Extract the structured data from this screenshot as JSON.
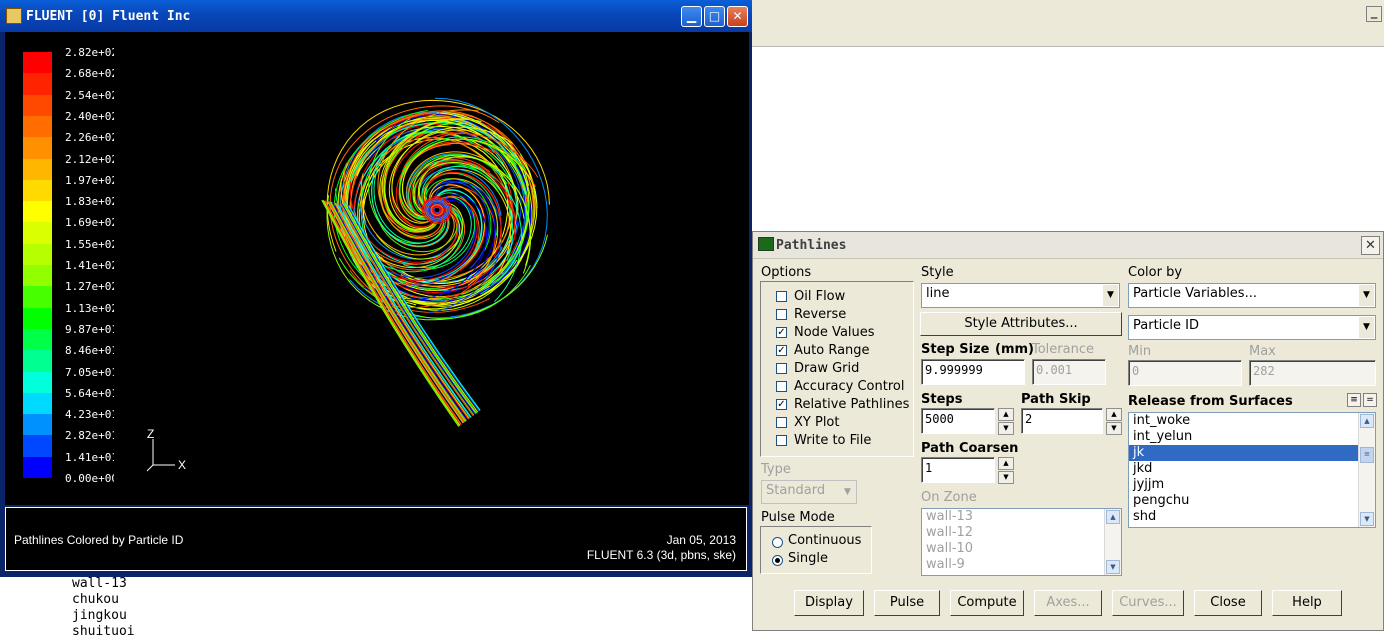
{
  "graphics_window": {
    "title": "FLUENT [0] Fluent Inc",
    "caption": "Pathlines Colored by Particle ID",
    "date": "Jan 05, 2013",
    "version": "FLUENT 6.3 (3d, pbns, ske)",
    "axis_z": "Z",
    "axis_x": "X",
    "colorbar": {
      "labels": [
        "2.82e+02",
        "2.68e+02",
        "2.54e+02",
        "2.40e+02",
        "2.26e+02",
        "2.12e+02",
        "1.97e+02",
        "1.83e+02",
        "1.69e+02",
        "1.55e+02",
        "1.41e+02",
        "1.27e+02",
        "1.13e+02",
        "9.87e+01",
        "8.46e+01",
        "7.05e+01",
        "5.64e+01",
        "4.23e+01",
        "2.82e+01",
        "1.41e+01",
        "0.00e+00"
      ],
      "colors": [
        "#ff0000",
        "#ff2400",
        "#ff4800",
        "#ff6d00",
        "#ff9100",
        "#ffb600",
        "#ffda00",
        "#ffff00",
        "#d9ff00",
        "#b6ff00",
        "#91ff00",
        "#48ff00",
        "#00ff00",
        "#00ff48",
        "#00ff91",
        "#00ffda",
        "#00daff",
        "#0091ff",
        "#0048ff",
        "#0000ff"
      ]
    }
  },
  "console": {
    "lines": [
      "wall-13",
      "chukou",
      "jingkou",
      "shuituoi"
    ]
  },
  "dialog": {
    "title": "Pathlines",
    "options": {
      "title": "Options",
      "items": [
        {
          "label": "Oil Flow",
          "checked": false
        },
        {
          "label": "Reverse",
          "checked": false
        },
        {
          "label": "Node Values",
          "checked": true
        },
        {
          "label": "Auto Range",
          "checked": true
        },
        {
          "label": "Draw Grid",
          "checked": false
        },
        {
          "label": "Accuracy Control",
          "checked": false
        },
        {
          "label": "Relative Pathlines",
          "checked": true
        },
        {
          "label": "XY Plot",
          "checked": false
        },
        {
          "label": "Write to File",
          "checked": false
        }
      ]
    },
    "type": {
      "label": "Type",
      "value": "Standard"
    },
    "pulse_mode": {
      "label": "Pulse Mode",
      "continuous": "Continuous",
      "single": "Single",
      "selected": "Single"
    },
    "style": {
      "label": "Style",
      "value": "line",
      "attributes_button": "Style Attributes..."
    },
    "step_size": {
      "label": "Step Size",
      "unit": "(mm)",
      "value": "9.999999"
    },
    "tolerance": {
      "label": "Tolerance",
      "value": "0.001"
    },
    "steps": {
      "label": "Steps",
      "value": "5000"
    },
    "path_skip": {
      "label": "Path Skip",
      "value": "2"
    },
    "path_coarsen": {
      "label": "Path Coarsen",
      "value": "1"
    },
    "on_zone": {
      "label": "On Zone",
      "items": [
        "wall-13",
        "wall-12",
        "wall-10",
        "wall-9"
      ]
    },
    "color_by": {
      "label": "Color by",
      "value1": "Particle Variables...",
      "value2": "Particle ID"
    },
    "min": {
      "label": "Min",
      "value": "0"
    },
    "max": {
      "label": "Max",
      "value": "282"
    },
    "release": {
      "label": "Release from Surfaces",
      "items": [
        "int_woke",
        "int_yelun",
        "jk",
        "jkd",
        "jyjjm",
        "pengchu",
        "shd"
      ],
      "selected": "jk"
    },
    "buttons": {
      "display": "Display",
      "pulse": "Pulse",
      "compute": "Compute",
      "axes": "Axes...",
      "curves": "Curves...",
      "close": "Close",
      "help": "Help"
    }
  }
}
